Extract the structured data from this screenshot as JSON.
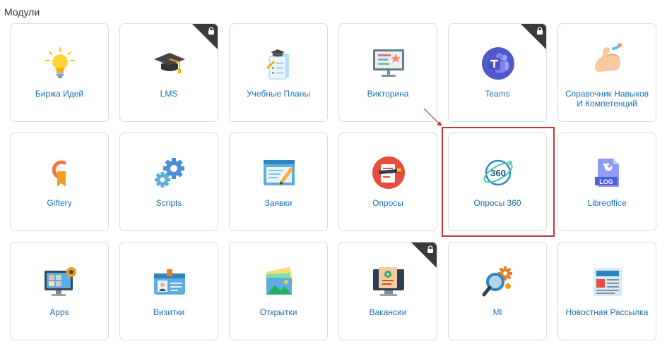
{
  "section_title": "Модули",
  "modules": [
    {
      "label": "Биржа Идей",
      "icon": "lightbulb-icon",
      "locked": false
    },
    {
      "label": "LMS",
      "icon": "graduation-cap-icon",
      "locked": true
    },
    {
      "label": "Учебные Планы",
      "icon": "study-plan-icon",
      "locked": false
    },
    {
      "label": "Викторина",
      "icon": "quiz-board-icon",
      "locked": false
    },
    {
      "label": "Teams",
      "icon": "teams-icon",
      "locked": true
    },
    {
      "label": "Справочник Навыков И Компетенций",
      "icon": "skills-muscle-icon",
      "locked": false
    },
    {
      "label": "Giftery",
      "icon": "giftery-icon",
      "locked": false
    },
    {
      "label": "Scripts",
      "icon": "gears-icon",
      "locked": false
    },
    {
      "label": "Заявки",
      "icon": "application-form-icon",
      "locked": false
    },
    {
      "label": "Опросы",
      "icon": "survey-icon",
      "locked": false
    },
    {
      "label": "Опросы 360",
      "icon": "survey-360-icon",
      "locked": false
    },
    {
      "label": "Libreoffice",
      "icon": "log-file-icon",
      "locked": false
    },
    {
      "label": "Apps",
      "icon": "apps-monitor-icon",
      "locked": false
    },
    {
      "label": "Визитки",
      "icon": "business-card-icon",
      "locked": false
    },
    {
      "label": "Открытки",
      "icon": "postcards-icon",
      "locked": false
    },
    {
      "label": "Вакансии",
      "icon": "vacancies-icon",
      "locked": true
    },
    {
      "label": "Ml",
      "icon": "ml-search-icon",
      "locked": false
    },
    {
      "label": "Новостная Рассылка",
      "icon": "newsletter-icon",
      "locked": false
    }
  ],
  "highlighted_module": "Опросы 360",
  "colors": {
    "label": "#1d6fb8",
    "highlight": "#c0392b",
    "lock_badge": "#3a3a3a"
  }
}
